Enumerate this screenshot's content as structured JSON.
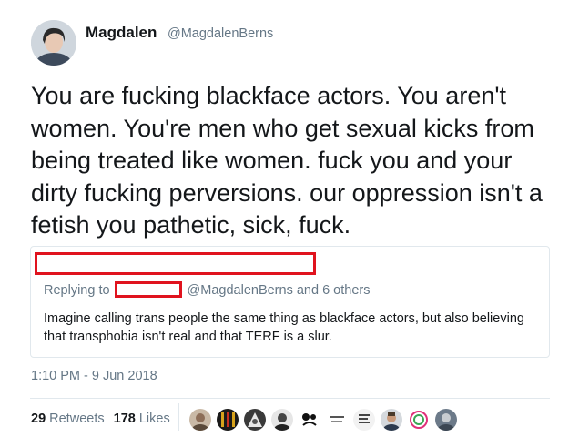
{
  "author": {
    "display_name": "Magdalen",
    "handle": "@MagdalenBerns",
    "avatar_icon": "profile-avatar"
  },
  "tweet": {
    "text": "You are fucking blackface actors. You aren't women. You're men who get sexual kicks from being treated like women. fuck you and your dirty fucking perversions. our oppression isn't a fetish you pathetic, sick, fuck."
  },
  "quoted": {
    "replying_label": "Replying to",
    "mentions": "@MagdalenBerns and 6 others",
    "text": "Imagine calling trans people the same thing as blackface actors, but also believing that transphobia isn't real and that TERF is a slur."
  },
  "timestamp": "1:10 PM - 9 Jun 2018",
  "stats": {
    "retweets_count": "29",
    "retweets_label": "Retweets",
    "likes_count": "178",
    "likes_label": "Likes"
  },
  "colors": {
    "text": "#14171a",
    "secondary": "#657786",
    "border": "#e1e8ed",
    "redaction": "#e0131e"
  }
}
